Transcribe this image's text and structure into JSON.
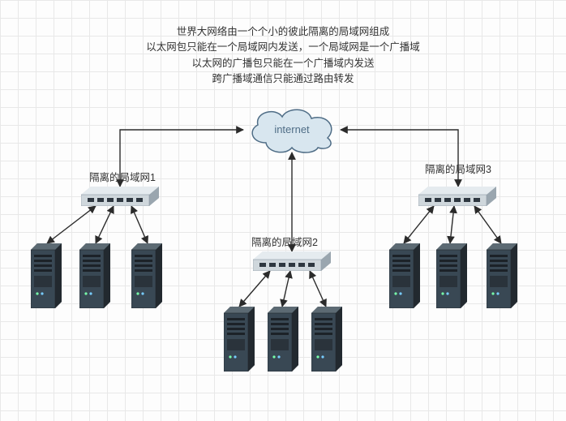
{
  "description": {
    "line1": "世界大网络由一个个小的彼此隔离的局域网组成",
    "line2": "以太网包只能在一个局域网内发送，一个局域网是一个广播域",
    "line3": "以太网的广播包只能在一个广播域内发送",
    "line4": "跨广播域通信只能通过路由转发"
  },
  "cloud": {
    "label": "internet"
  },
  "lans": {
    "lan1": {
      "label": "隔离的局域网1"
    },
    "lan2": {
      "label": "隔离的局域网2"
    },
    "lan3": {
      "label": "隔离的局域网3"
    }
  },
  "colors": {
    "cloudStroke": "#4f6d86",
    "cloudFill": "#d8e6ef",
    "switchBody": "#cfd7dc",
    "switchDark": "#8d99a3",
    "switchPort": "#2e3740",
    "serverBody": "#394854",
    "serverLight": "#5c6a73",
    "serverDark": "#22292f",
    "arrow": "#2b2b2b"
  }
}
